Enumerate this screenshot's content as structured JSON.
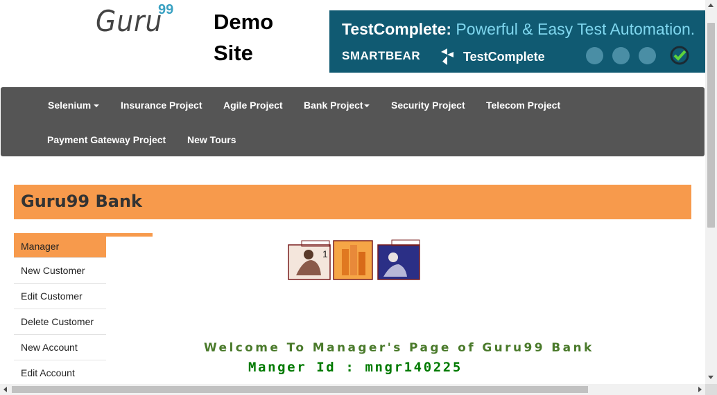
{
  "header": {
    "logo_text": "Guru",
    "logo_superscript": "99",
    "site_title": "Demo Site"
  },
  "banner": {
    "headline_brand": "TestComplete:",
    "headline_tagline": " Powerful & Easy Test Automation.",
    "company": "SMARTBEAR",
    "product": "TestComplete",
    "icons": [
      "mobile-icon",
      "desktop-icon",
      "web-icon",
      "check-cycle-icon"
    ]
  },
  "nav": {
    "items": [
      {
        "label": "Selenium",
        "dropdown": true
      },
      {
        "label": "Insurance Project",
        "dropdown": false
      },
      {
        "label": "Agile Project",
        "dropdown": false
      },
      {
        "label": "Bank Project",
        "dropdown": true
      },
      {
        "label": "Security Project",
        "dropdown": false
      },
      {
        "label": "Telecom Project",
        "dropdown": false
      },
      {
        "label": "Payment Gateway Project",
        "dropdown": false
      },
      {
        "label": "New Tours",
        "dropdown": false
      }
    ]
  },
  "bank": {
    "title": "Guru99 Bank"
  },
  "sidebar": {
    "items": [
      {
        "label": "Manager",
        "active": true
      },
      {
        "label": "New Customer",
        "active": false
      },
      {
        "label": "Edit Customer",
        "active": false
      },
      {
        "label": "Delete Customer",
        "active": false
      },
      {
        "label": "New Account",
        "active": false
      },
      {
        "label": "Edit Account",
        "active": false
      }
    ]
  },
  "main": {
    "welcome_text": "Welcome To Manager's Page of Guru99 Bank",
    "manager_id_text": "Manger Id : mngr140225"
  },
  "colors": {
    "accent_orange": "#f79a4c",
    "nav_bg": "#555555",
    "banner_bg": "#105a72",
    "welcome_green": "#4a7a2b",
    "id_green": "#007a00"
  }
}
